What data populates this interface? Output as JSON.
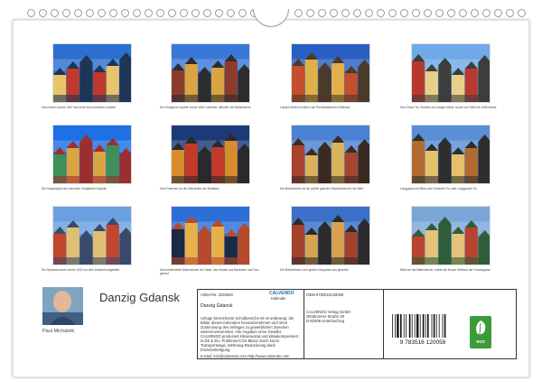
{
  "calendar": {
    "title": "Danzig Gdansk",
    "author": "Paul Michalzik"
  },
  "thumbnails": [
    {
      "caption": "Das Krantor wurde 1367 das erste Mal urkundlich erwähnt"
    },
    {
      "caption": "Die Königliche Kapelle wurde 1682 vollendet, dahinter die Marienkirche"
    },
    {
      "caption": "Langen Markt mit Blick zum Rechtstädtischen Rathaus"
    },
    {
      "caption": "Das Grüne Tor, Stadttor am Langen Markt, wurde von 1564 bis 1568 erbaut"
    },
    {
      "caption": "Die Hauptkuppel der barocken Königlichen Kapelle"
    },
    {
      "caption": "Das Prasentor an der Uferstraße der Mottlawa"
    },
    {
      "caption": "Die Marienkirche ist die größte gotische Backsteinkirche der Welt"
    },
    {
      "caption": "Langgasse mit Blick zum Goldenen Tor oder Langgasser Tor"
    },
    {
      "caption": "Der Neptunbrunnen wurde 1633 vor dem Artushof aufgestellt"
    },
    {
      "caption": "Das bekannteste Wahrzeichen der Stadt, das Krantor aus Backstein und Holz gebaut"
    },
    {
      "caption": "Die Marienkirche vom großen Zeughaus aus gesehen"
    },
    {
      "caption": "Blick auf die Marienkirche, rechts die Neuen Rathaus der Frauengasse"
    }
  ],
  "info": {
    "article_no": "Artikel-Nr. 2026646",
    "brand": "CALVENDO",
    "brand_tag": "Kalender",
    "short_title": "Danzig Gdansk",
    "description": "Unfuge bezeichnete Schulbereiche ist es unbewegt, die Bilder dieses Kalenders herauszunehmen und ohne Zustimmung des Verlages zu gewerblichen Zwecken weiterzuverwenden. Alle Angaben ohne Gewähr.",
    "calvendo_note": "CALVENDO produziert klimaneutral und klimakompensiert in DE & EU. Probleme/CO2-Bilanz durch kurze Transportwege, Mehrweg-Reduzierung dank Einzelanfertigung.",
    "contact": "E-Mail: info@calvendo.com  http://www.calvendo.com",
    "isbn": "ISBN 9783516120059",
    "publisher_line1": "CALVENDO Verlag GmbH",
    "publisher_line2": "Ottobrunner Straße 39",
    "publisher_line3": "D-82008 Unterhaching",
    "barcode_digits": "9 783516 120059",
    "eco_label": "eco"
  }
}
